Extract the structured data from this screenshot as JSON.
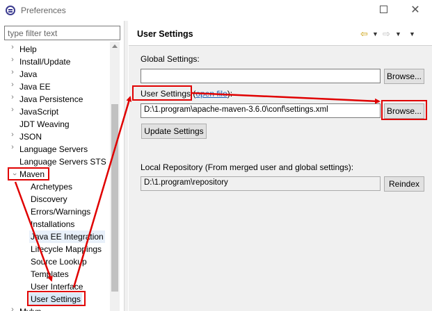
{
  "window": {
    "title": "Preferences"
  },
  "filter": {
    "placeholder": "type filter text"
  },
  "tree": {
    "top_items": [
      "Help",
      "Install/Update",
      "Java",
      "Java EE",
      "Java Persistence",
      "JavaScript",
      "JDT Weaving",
      "JSON",
      "Language Servers",
      "Language Servers STS"
    ],
    "maven": "Maven",
    "maven_children": [
      "Archetypes",
      "Discovery",
      "Errors/Warnings",
      "Installations",
      "Java EE Integration",
      "Lifecycle Mappings",
      "Source Lookup",
      "Templates",
      "User Interface",
      "User Settings"
    ],
    "next_item": "Mylyn"
  },
  "page": {
    "title": "User Settings",
    "global_label": "Global Settings:",
    "global_value": "",
    "user_label": "User Settings",
    "user_link": "open file",
    "user_value": "D:\\1.program\\apache-maven-3.6.0\\conf\\settings.xml",
    "browse_label": "Browse...",
    "update_label": "Update Settings",
    "local_label": "Local Repository (From merged user and global settings):",
    "local_value": "D:\\1.program\\repository",
    "reindex_label": "Reindex"
  }
}
